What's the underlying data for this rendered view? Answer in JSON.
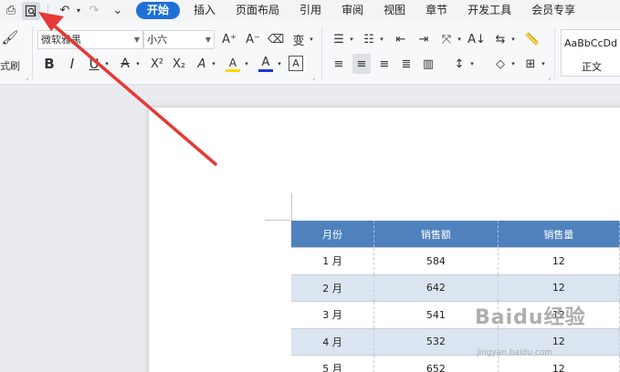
{
  "quick_access": {
    "print_icon": "printer-icon",
    "preview_icon": "print-preview-icon",
    "undo_icon": "undo-icon",
    "redo_icon": "redo-icon",
    "customize_icon": "chevron-down-icon"
  },
  "tabs": [
    {
      "label": "开始",
      "active": true
    },
    {
      "label": "插入"
    },
    {
      "label": "页面布局"
    },
    {
      "label": "引用"
    },
    {
      "label": "审阅"
    },
    {
      "label": "视图"
    },
    {
      "label": "章节"
    },
    {
      "label": "开发工具"
    },
    {
      "label": "会员专享"
    }
  ],
  "ribbon": {
    "format_painter_label": "式刷",
    "font_name": "微软雅黑",
    "font_size": "小六",
    "bold": "B",
    "italic": "I",
    "underline": "U",
    "strike": "A",
    "superscript": "X²",
    "subscript": "X₂",
    "text_effect": "A",
    "highlight": "A",
    "font_color": "A",
    "char_border": "A",
    "grow_font": "A⁺",
    "shrink_font": "A⁻",
    "pinyin": "变",
    "style_sample": "AaBbCcDd",
    "style_name": "正文"
  },
  "table": {
    "headers": [
      "月份",
      "销售额",
      "销售量"
    ],
    "rows": [
      [
        "1 月",
        "584",
        "12"
      ],
      [
        "2 月",
        "642",
        "12"
      ],
      [
        "3 月",
        "541",
        "12"
      ],
      [
        "4 月",
        "532",
        "12"
      ],
      [
        "5 月",
        "652",
        "12"
      ]
    ]
  },
  "watermark": {
    "logo": "Baidu经验",
    "url": "jingyan.baidu.com"
  },
  "colors": {
    "accent": "#1f6fd6",
    "header_fill": "#4f81bd",
    "band_fill": "#dbe5f1",
    "arrow": "#e53935",
    "highlight_bar": "#ffd800",
    "font_color_bar": "#1a35d6"
  }
}
